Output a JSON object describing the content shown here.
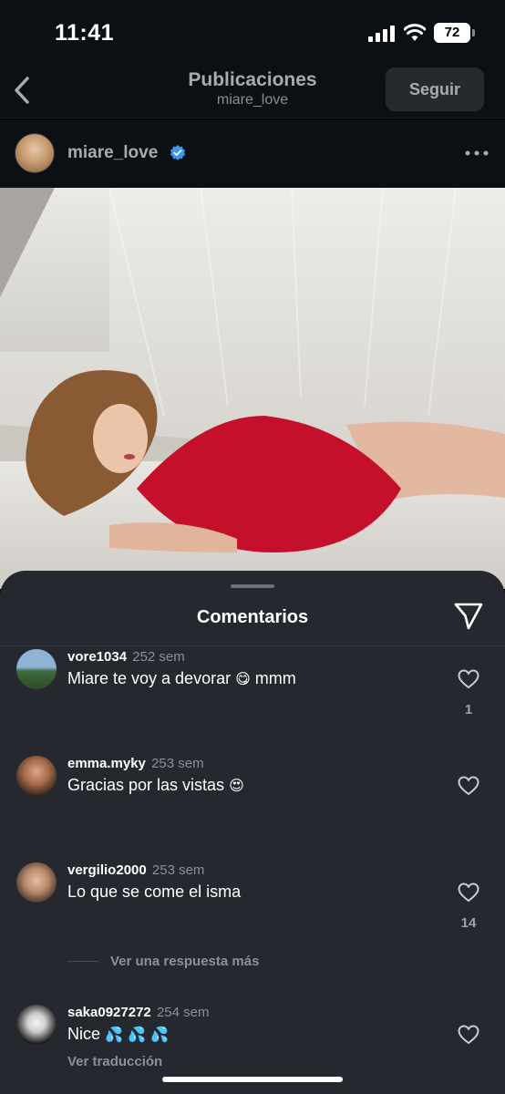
{
  "status_bar": {
    "time": "11:41",
    "battery": "72"
  },
  "header": {
    "title": "Publicaciones",
    "subtitle": "miare_love",
    "follow_label": "Seguir"
  },
  "post": {
    "username": "miare_love"
  },
  "comments_sheet": {
    "title": "Comentarios",
    "comments": [
      {
        "username": "vore1034",
        "time": "252 sem",
        "text": "Miare te voy a devorar",
        "emoji": "😋",
        "text_after": "mmm",
        "likes": "1"
      },
      {
        "username": "emma.myky",
        "time": "253 sem",
        "text": "Gracias por las vistas",
        "emoji": "😍",
        "text_after": "",
        "likes": ""
      },
      {
        "username": "vergilio2000",
        "time": "253 sem",
        "text": "Lo que se come el isma",
        "emoji": "",
        "text_after": "",
        "likes": "14"
      },
      {
        "username": "saka0927272",
        "time": "254 sem",
        "text": "Nice",
        "emoji": "💦 💦 💦",
        "text_after": "",
        "likes": "",
        "translate": "Ver traducción"
      }
    ],
    "view_more_replies": "Ver una respuesta más"
  },
  "colors": {
    "background": "#0c0f13",
    "sheet": "#25282e",
    "verified": "#3897f0",
    "swimsuit": "#c4102a"
  }
}
